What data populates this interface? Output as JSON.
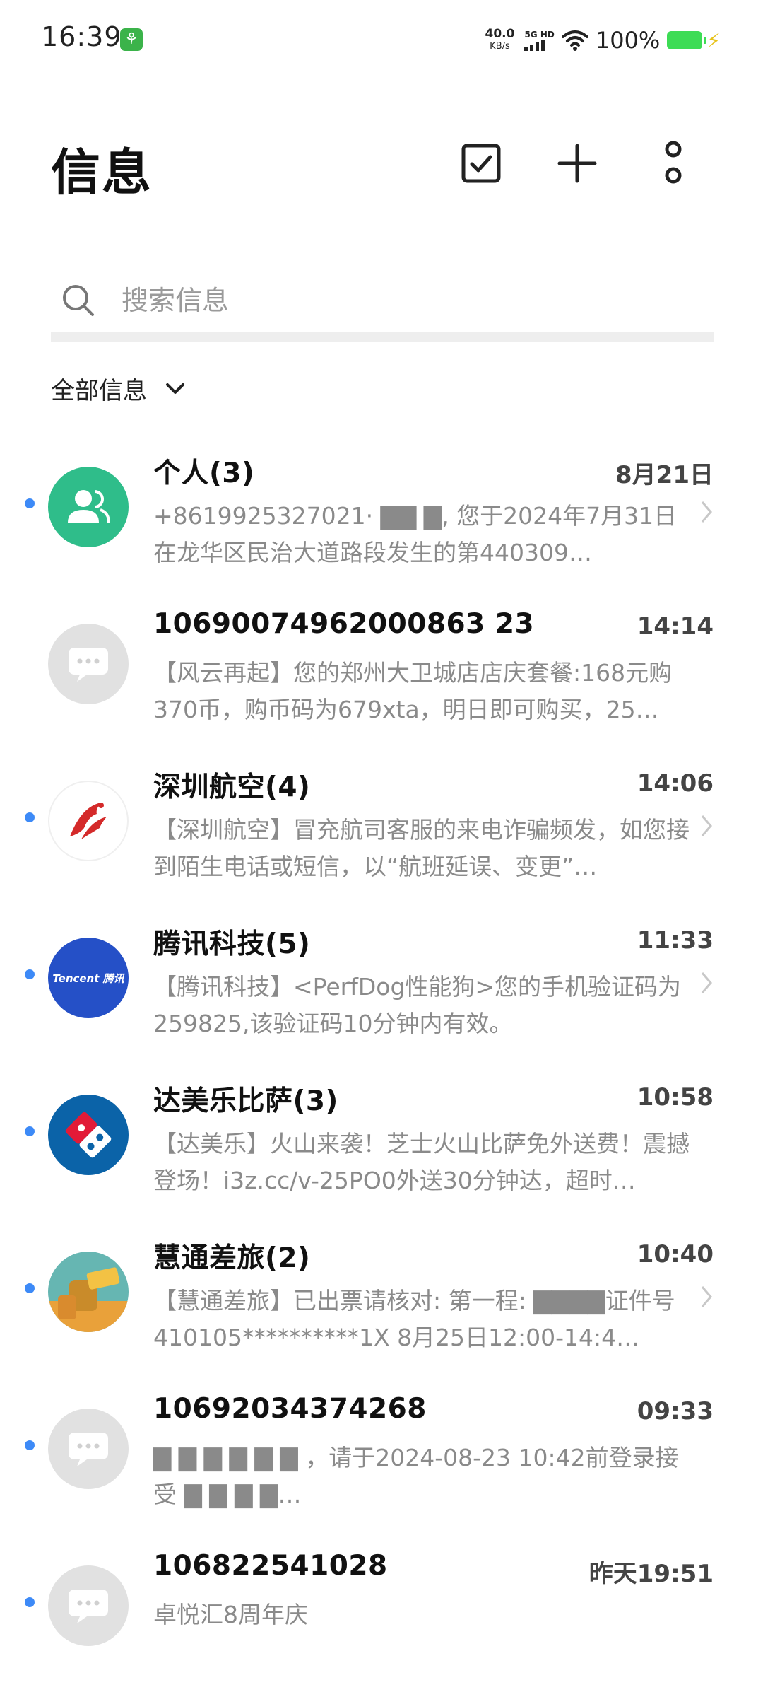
{
  "status_bar": {
    "time": "16:39",
    "net_speed_value": "40.0",
    "net_speed_unit": "KB/s",
    "network_type": "5G HD",
    "battery_percent": "100%",
    "battery_color": "#3ddc55"
  },
  "header": {
    "title": "信息",
    "icons": [
      "select-checkbox-icon",
      "add-icon",
      "more-vertical-icon"
    ]
  },
  "search": {
    "placeholder": "搜索信息"
  },
  "filter": {
    "label": "全部信息"
  },
  "accent_color": "#3d8af7",
  "conversations": [
    {
      "sender": "个人(3)",
      "time": "8月21日",
      "snippet": "+8619925327021· ▇▇ ▇, 您于2024年7月31日在龙华区民治大道路段发生的第440309…",
      "unread": true,
      "avatar": "contact-avatar-icon"
    },
    {
      "sender": "10690074962000863 23",
      "time": "14:14",
      "snippet": "【风云再起】您的郑州大卫城店店庆套餐:168元购370币，购币码为679xta，明日即可购买，25…",
      "unread": false,
      "avatar": "sms-avatar-icon"
    },
    {
      "sender": "深圳航空(4)",
      "time": "14:06",
      "snippet": "【深圳航空】冒充航司客服的来电诈骗频发，如您接到陌生电话或短信，以“航班延误、变更”…",
      "unread": true,
      "avatar": "shenzhen-airlines-logo"
    },
    {
      "sender": "腾讯科技(5)",
      "time": "11:33",
      "snippet": "【腾讯科技】<PerfDog性能狗>您的手机验证码为259825,该验证码10分钟内有效。",
      "unread": true,
      "avatar": "tencent-logo",
      "avatar_text": "Tencent 腾讯"
    },
    {
      "sender": "达美乐比萨(3)",
      "time": "10:58",
      "snippet": "【达美乐】火山来袭！芝士火山比萨免外送费！震撼登场！i3z.cc/v-25PO0外送30分钟达，超时…",
      "unread": true,
      "avatar": "dominos-logo"
    },
    {
      "sender": "慧通差旅(2)",
      "time": "10:40",
      "snippet": "【慧通差旅】已出票请核对: 第一程: ▇▇▇▇证件号410105**********1X 8月25日12:00-14:4…",
      "unread": true,
      "avatar": "travel-avatar"
    },
    {
      "sender": "10692034374268",
      "time": "09:33",
      "snippet": "▇ ▇ ▇ ▇ ▇ ▇ ，请于2024-08-23 10:42前登录接受 ▇ ▇ ▇ ▇…",
      "unread": true,
      "avatar": "sms-avatar-icon"
    },
    {
      "sender": "106822541028",
      "time": "昨天19:51",
      "snippet": "卓悦汇8周年庆",
      "unread": true,
      "avatar": "sms-avatar-icon"
    }
  ]
}
